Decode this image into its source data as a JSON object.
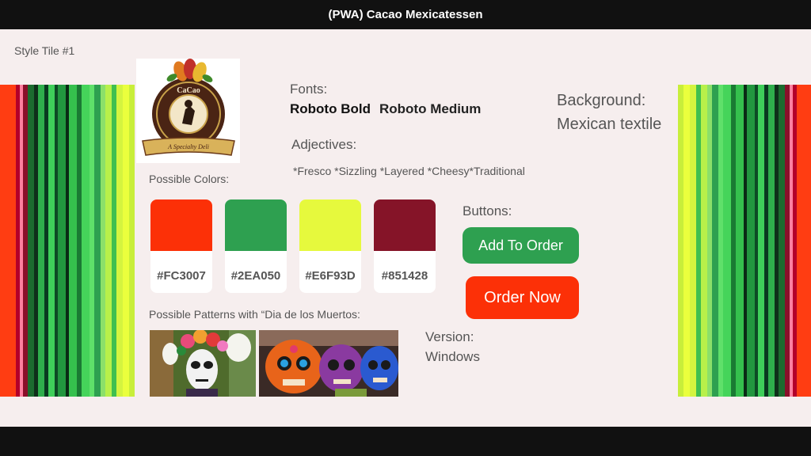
{
  "window": {
    "title": "(PWA) Cacao Mexicatessen"
  },
  "tile": {
    "title": "Style Tile #1"
  },
  "logo": {
    "name": "CaCao Mexicatessen",
    "tagline": "A Specialty Deli"
  },
  "fonts": {
    "label": "Fonts:",
    "bold": "Roboto Bold",
    "medium": "Roboto Medium"
  },
  "background": {
    "label": "Background:",
    "value": "Mexican textile"
  },
  "adjectives": {
    "label": "Adjectives:",
    "value": "*Fresco *Sizzling *Layered *Cheesy*Traditional"
  },
  "colors": {
    "label": "Possible Colors:",
    "swatches": [
      {
        "hex": "#FC3007"
      },
      {
        "hex": "#2EA050"
      },
      {
        "hex": "#E6F93D"
      },
      {
        "hex": "#851428"
      }
    ]
  },
  "buttons": {
    "label": "Buttons:",
    "add_to_order": "Add To Order",
    "order_now": "Order Now"
  },
  "patterns": {
    "label": "Possible Patterns with “Dia de los Muertos:"
  },
  "version": {
    "label": "Version:",
    "value": "Windows"
  }
}
